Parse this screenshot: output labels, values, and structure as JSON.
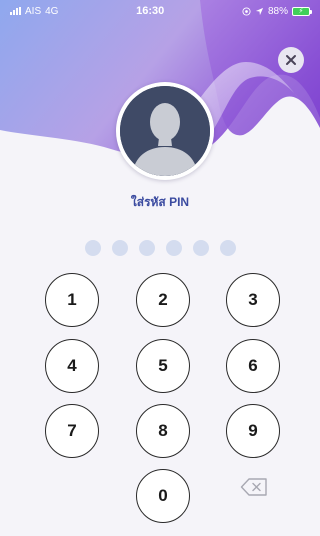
{
  "status_bar": {
    "carrier": "AIS",
    "network": "4G",
    "time": "16:30",
    "battery": "88%",
    "battery_color": "#40d05a"
  },
  "header": {
    "gradient_colors": [
      "#8fa8ee",
      "#b49be3",
      "#8c4fd6"
    ]
  },
  "close_button": {
    "icon": "close-icon"
  },
  "avatar": {
    "icon": "user-silhouette-icon"
  },
  "pin_title": "ใส่รหัส PIN",
  "pin": {
    "length": 6,
    "filled": 0,
    "dot_color": "#d4dcef"
  },
  "keypad": {
    "keys": [
      "1",
      "2",
      "3",
      "4",
      "5",
      "6",
      "7",
      "8",
      "9",
      "0"
    ],
    "backspace_icon": "backspace-icon"
  }
}
